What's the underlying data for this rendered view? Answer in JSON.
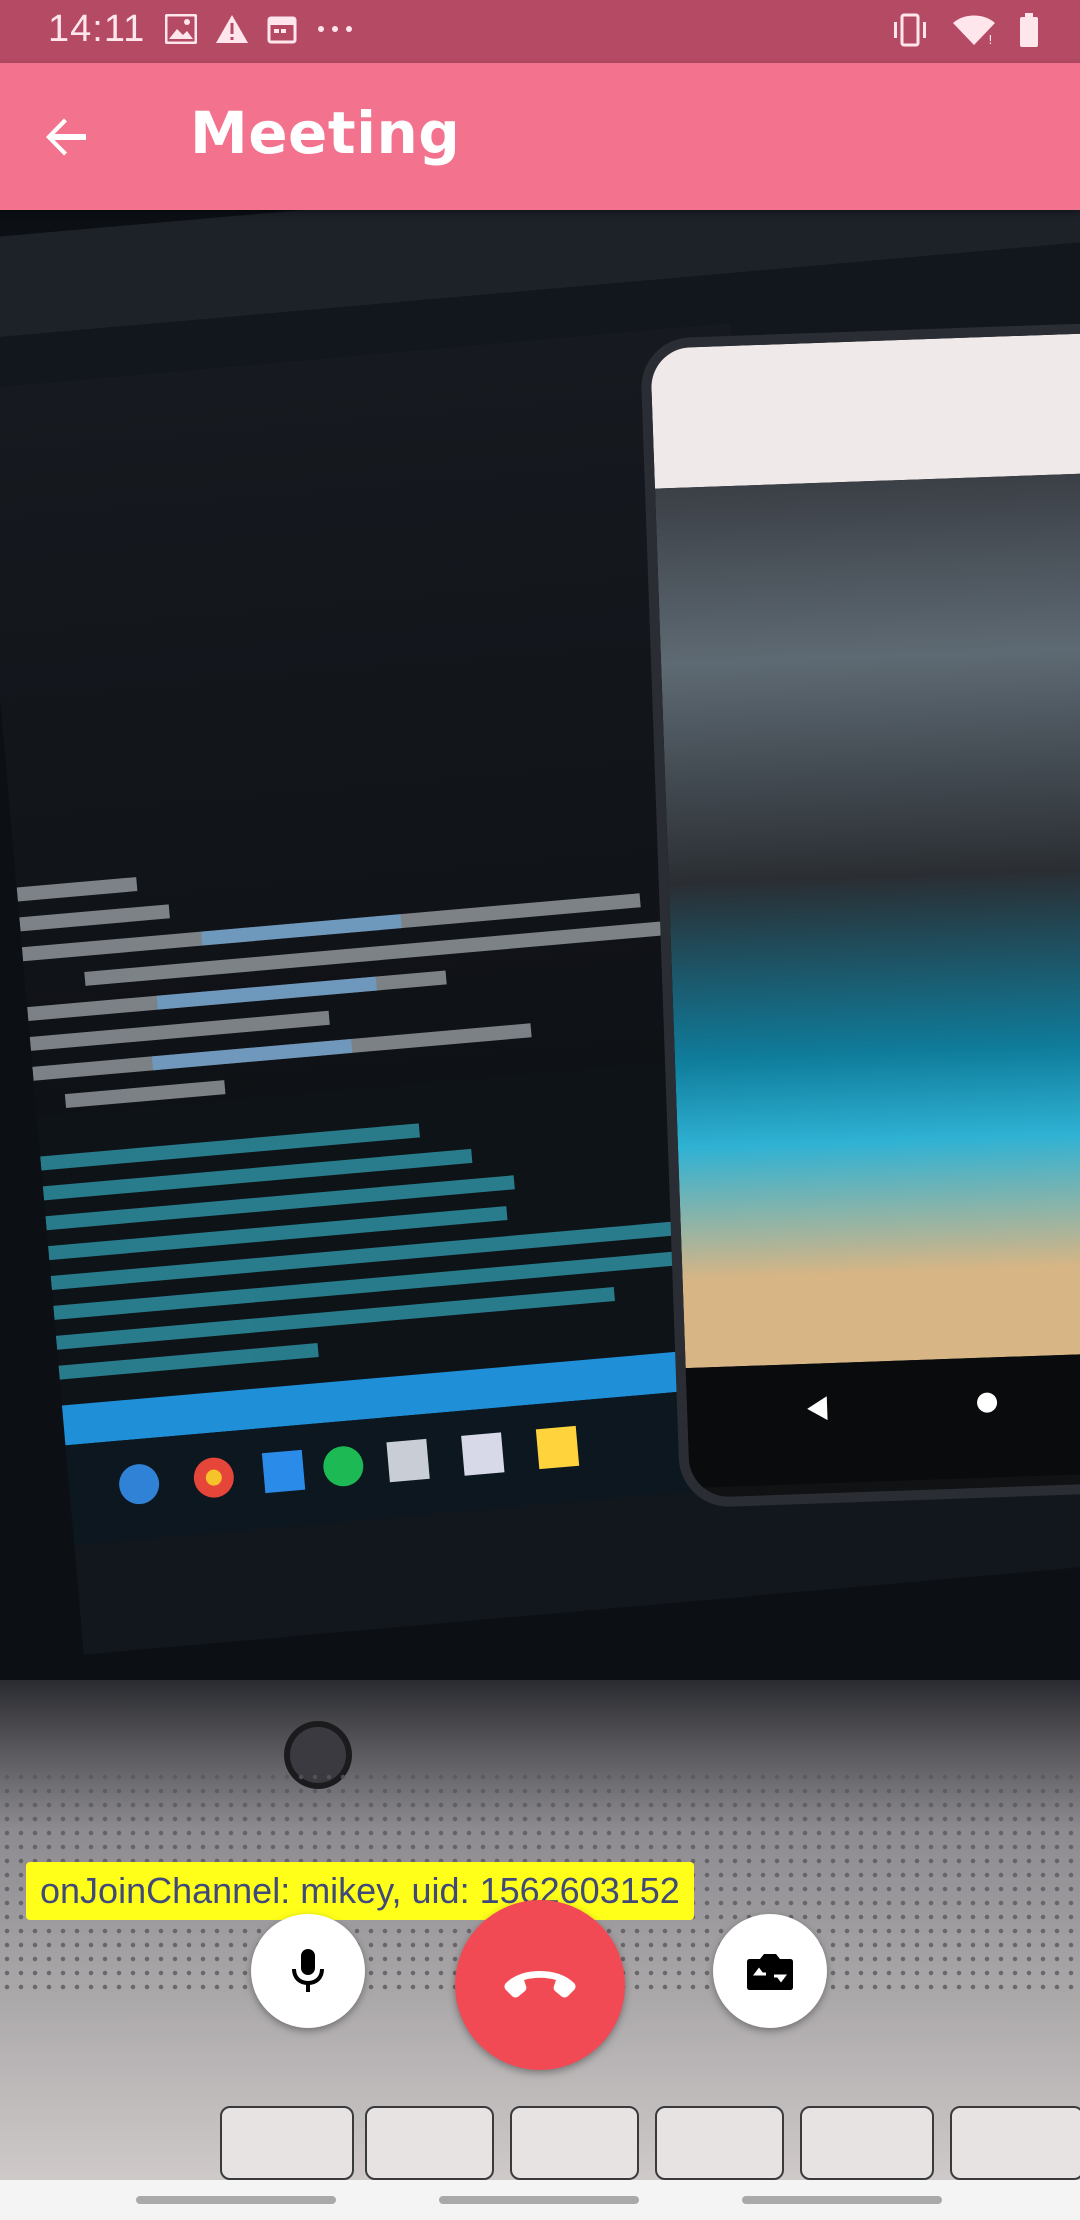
{
  "status_bar": {
    "time": "14:11",
    "left_icons": [
      "image-icon",
      "warning-icon",
      "calendar-icon",
      "more-dots-icon"
    ],
    "right_icons": [
      "vibrate-icon",
      "wifi-icon",
      "battery-icon"
    ],
    "background": "#b44a64"
  },
  "app_bar": {
    "title": "Meeting",
    "back_icon": "arrow-left-icon",
    "background": "#f3738f"
  },
  "video": {
    "overlay_text": "onJoinChannel: mikey, uid: 1562603152"
  },
  "controls": {
    "mic_icon": "microphone-icon",
    "end_call_icon": "phone-hangup-icon",
    "switch_camera_icon": "switch-camera-icon",
    "end_call_color": "#f24a54"
  },
  "nav_bar": {
    "background": "#f4f4f4"
  }
}
